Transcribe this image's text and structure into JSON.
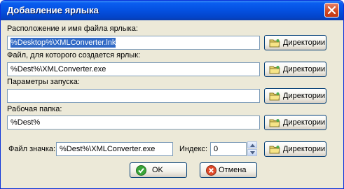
{
  "window": {
    "title": "Добавление ярлыка"
  },
  "rows": [
    {
      "label": "Расположение и имя файла ярлыка:",
      "value": "%Desktop%\\XMLConverter.lnk",
      "button": "Директории"
    },
    {
      "label": "Файл, для которого создается ярлык:",
      "value": "%Dest%\\XMLConverter.exe",
      "button": "Директории"
    },
    {
      "label": "Параметры запуска:",
      "value": "",
      "button": "Директории"
    },
    {
      "label": "Рабочая папка:",
      "value": "%Dest%",
      "button": "Директории"
    }
  ],
  "icon_row": {
    "label": "Файл значка:",
    "value": "%Dest%\\XMLConverter.exe",
    "index_label": "Индекс:",
    "index_value": "0",
    "button": "Директории"
  },
  "actions": {
    "ok": "OK",
    "cancel": "Отмена"
  },
  "colors": {
    "title_bar": "#0450e0",
    "selection": "#316ac5",
    "dialog_bg": "#ece9d8"
  },
  "icons": [
    "close-icon",
    "folder-icon",
    "spin-up-icon",
    "spin-down-icon",
    "check-icon",
    "cancel-icon"
  ]
}
